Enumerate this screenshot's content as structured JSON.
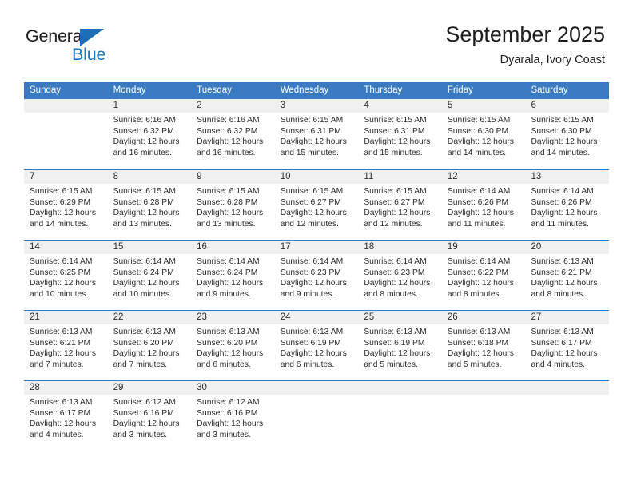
{
  "logo": {
    "text_top": "General",
    "text_bottom": "Blue",
    "icon": "triangle-icon",
    "color_top": "#1b1b1b",
    "color_bottom": "#1c79c0",
    "color_triangle": "#1c6fb4"
  },
  "header": {
    "title": "September 2025",
    "subtitle": "Dyarala, Ivory Coast"
  },
  "theme": {
    "header_bg": "#3a7ac0",
    "header_text": "#ffffff",
    "day_number_bg": "#f0f0f0",
    "cell_bg": "#ffffff",
    "text": "#2b2b2b"
  },
  "calendar": {
    "weekdays": [
      "Sunday",
      "Monday",
      "Tuesday",
      "Wednesday",
      "Thursday",
      "Friday",
      "Saturday"
    ],
    "weeks": [
      [
        {
          "day": "",
          "sunrise": "",
          "sunset": "",
          "daylight": "",
          "empty": true
        },
        {
          "day": "1",
          "sunrise": "Sunrise: 6:16 AM",
          "sunset": "Sunset: 6:32 PM",
          "daylight": "Daylight: 12 hours and 16 minutes."
        },
        {
          "day": "2",
          "sunrise": "Sunrise: 6:16 AM",
          "sunset": "Sunset: 6:32 PM",
          "daylight": "Daylight: 12 hours and 16 minutes."
        },
        {
          "day": "3",
          "sunrise": "Sunrise: 6:15 AM",
          "sunset": "Sunset: 6:31 PM",
          "daylight": "Daylight: 12 hours and 15 minutes."
        },
        {
          "day": "4",
          "sunrise": "Sunrise: 6:15 AM",
          "sunset": "Sunset: 6:31 PM",
          "daylight": "Daylight: 12 hours and 15 minutes."
        },
        {
          "day": "5",
          "sunrise": "Sunrise: 6:15 AM",
          "sunset": "Sunset: 6:30 PM",
          "daylight": "Daylight: 12 hours and 14 minutes."
        },
        {
          "day": "6",
          "sunrise": "Sunrise: 6:15 AM",
          "sunset": "Sunset: 6:30 PM",
          "daylight": "Daylight: 12 hours and 14 minutes."
        }
      ],
      [
        {
          "day": "7",
          "sunrise": "Sunrise: 6:15 AM",
          "sunset": "Sunset: 6:29 PM",
          "daylight": "Daylight: 12 hours and 14 minutes."
        },
        {
          "day": "8",
          "sunrise": "Sunrise: 6:15 AM",
          "sunset": "Sunset: 6:28 PM",
          "daylight": "Daylight: 12 hours and 13 minutes."
        },
        {
          "day": "9",
          "sunrise": "Sunrise: 6:15 AM",
          "sunset": "Sunset: 6:28 PM",
          "daylight": "Daylight: 12 hours and 13 minutes."
        },
        {
          "day": "10",
          "sunrise": "Sunrise: 6:15 AM",
          "sunset": "Sunset: 6:27 PM",
          "daylight": "Daylight: 12 hours and 12 minutes."
        },
        {
          "day": "11",
          "sunrise": "Sunrise: 6:15 AM",
          "sunset": "Sunset: 6:27 PM",
          "daylight": "Daylight: 12 hours and 12 minutes."
        },
        {
          "day": "12",
          "sunrise": "Sunrise: 6:14 AM",
          "sunset": "Sunset: 6:26 PM",
          "daylight": "Daylight: 12 hours and 11 minutes."
        },
        {
          "day": "13",
          "sunrise": "Sunrise: 6:14 AM",
          "sunset": "Sunset: 6:26 PM",
          "daylight": "Daylight: 12 hours and 11 minutes."
        }
      ],
      [
        {
          "day": "14",
          "sunrise": "Sunrise: 6:14 AM",
          "sunset": "Sunset: 6:25 PM",
          "daylight": "Daylight: 12 hours and 10 minutes."
        },
        {
          "day": "15",
          "sunrise": "Sunrise: 6:14 AM",
          "sunset": "Sunset: 6:24 PM",
          "daylight": "Daylight: 12 hours and 10 minutes."
        },
        {
          "day": "16",
          "sunrise": "Sunrise: 6:14 AM",
          "sunset": "Sunset: 6:24 PM",
          "daylight": "Daylight: 12 hours and 9 minutes."
        },
        {
          "day": "17",
          "sunrise": "Sunrise: 6:14 AM",
          "sunset": "Sunset: 6:23 PM",
          "daylight": "Daylight: 12 hours and 9 minutes."
        },
        {
          "day": "18",
          "sunrise": "Sunrise: 6:14 AM",
          "sunset": "Sunset: 6:23 PM",
          "daylight": "Daylight: 12 hours and 8 minutes."
        },
        {
          "day": "19",
          "sunrise": "Sunrise: 6:14 AM",
          "sunset": "Sunset: 6:22 PM",
          "daylight": "Daylight: 12 hours and 8 minutes."
        },
        {
          "day": "20",
          "sunrise": "Sunrise: 6:13 AM",
          "sunset": "Sunset: 6:21 PM",
          "daylight": "Daylight: 12 hours and 8 minutes."
        }
      ],
      [
        {
          "day": "21",
          "sunrise": "Sunrise: 6:13 AM",
          "sunset": "Sunset: 6:21 PM",
          "daylight": "Daylight: 12 hours and 7 minutes."
        },
        {
          "day": "22",
          "sunrise": "Sunrise: 6:13 AM",
          "sunset": "Sunset: 6:20 PM",
          "daylight": "Daylight: 12 hours and 7 minutes."
        },
        {
          "day": "23",
          "sunrise": "Sunrise: 6:13 AM",
          "sunset": "Sunset: 6:20 PM",
          "daylight": "Daylight: 12 hours and 6 minutes."
        },
        {
          "day": "24",
          "sunrise": "Sunrise: 6:13 AM",
          "sunset": "Sunset: 6:19 PM",
          "daylight": "Daylight: 12 hours and 6 minutes."
        },
        {
          "day": "25",
          "sunrise": "Sunrise: 6:13 AM",
          "sunset": "Sunset: 6:19 PM",
          "daylight": "Daylight: 12 hours and 5 minutes."
        },
        {
          "day": "26",
          "sunrise": "Sunrise: 6:13 AM",
          "sunset": "Sunset: 6:18 PM",
          "daylight": "Daylight: 12 hours and 5 minutes."
        },
        {
          "day": "27",
          "sunrise": "Sunrise: 6:13 AM",
          "sunset": "Sunset: 6:17 PM",
          "daylight": "Daylight: 12 hours and 4 minutes."
        }
      ],
      [
        {
          "day": "28",
          "sunrise": "Sunrise: 6:13 AM",
          "sunset": "Sunset: 6:17 PM",
          "daylight": "Daylight: 12 hours and 4 minutes."
        },
        {
          "day": "29",
          "sunrise": "Sunrise: 6:12 AM",
          "sunset": "Sunset: 6:16 PM",
          "daylight": "Daylight: 12 hours and 3 minutes."
        },
        {
          "day": "30",
          "sunrise": "Sunrise: 6:12 AM",
          "sunset": "Sunset: 6:16 PM",
          "daylight": "Daylight: 12 hours and 3 minutes."
        },
        {
          "day": "",
          "sunrise": "",
          "sunset": "",
          "daylight": "",
          "empty": true
        },
        {
          "day": "",
          "sunrise": "",
          "sunset": "",
          "daylight": "",
          "empty": true
        },
        {
          "day": "",
          "sunrise": "",
          "sunset": "",
          "daylight": "",
          "empty": true
        },
        {
          "day": "",
          "sunrise": "",
          "sunset": "",
          "daylight": "",
          "empty": true
        }
      ]
    ]
  }
}
